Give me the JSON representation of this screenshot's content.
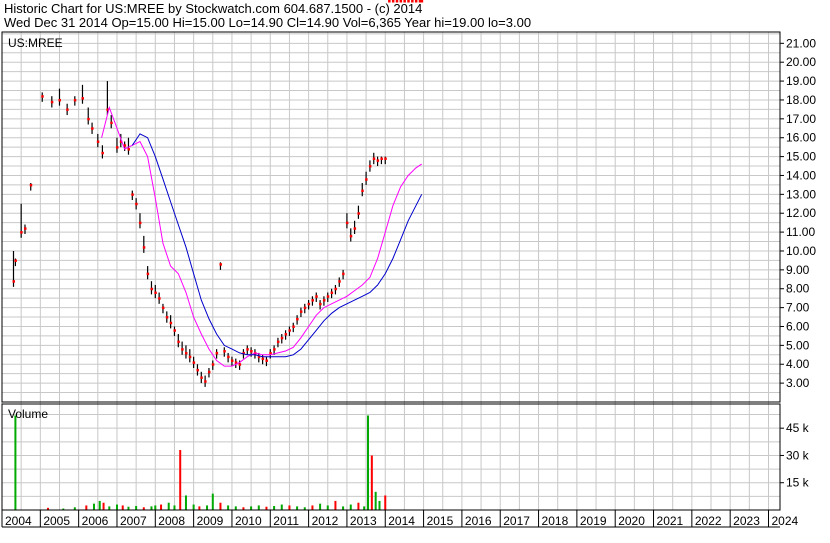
{
  "header": {
    "line1": "Historic Chart for US:MREE by Stockwatch.com 604.687.1500 - (c) 2014",
    "line2": "Wed Dec 31 2014   Op=15.00  Hi=15.00  Lo=14.90  Cl=14.90  Vol=6,365   Year hi=19.00  lo=3.00"
  },
  "colors": {
    "grid": "#c8c8c8",
    "price_bar": "#000000",
    "close_dot": "#ff0000",
    "ma_short": "#ff00ff",
    "ma_long": "#0000cc",
    "volume_up": "#00aa00",
    "volume_down": "#ff0000"
  },
  "chart_data": {
    "type": "line",
    "symbol_label": "US:MREE",
    "volume_label": "Volume",
    "x_ticks": [
      "2004",
      "2005",
      "2006",
      "2007",
      "2008",
      "2009",
      "2010",
      "2011",
      "2012",
      "2013",
      "2014",
      "2015",
      "2016",
      "2017",
      "2018",
      "2019",
      "2020",
      "2021",
      "2022",
      "2023",
      "2024"
    ],
    "y_ticks": [
      "3.00",
      "4.00",
      "5.00",
      "6.00",
      "7.00",
      "8.00",
      "9.00",
      "10.00",
      "11.00",
      "12.00",
      "13.00",
      "14.00",
      "15.00",
      "16.00",
      "17.00",
      "18.00",
      "19.00",
      "20.00",
      "21.00"
    ],
    "ylim": [
      2.0,
      21.6
    ],
    "volume_ticks": [
      "15 k",
      "30 k",
      "45 k"
    ],
    "volume_ylim": [
      0,
      55000
    ],
    "xlim": [
      2004.0,
      2024.3
    ],
    "series": [
      {
        "role": "price",
        "x": [
          2004.3,
          2004.35,
          2004.5,
          2004.6,
          2004.75,
          2005.05,
          2005.3,
          2005.5,
          2005.7,
          2005.9,
          2006.1,
          2006.25,
          2006.35,
          2006.5,
          2006.62,
          2006.75,
          2006.85,
          2007.0,
          2007.1,
          2007.2,
          2007.3,
          2007.4,
          2007.5,
          2007.6,
          2007.7,
          2007.8,
          2007.9,
          2008.0,
          2008.1,
          2008.2,
          2008.3,
          2008.4,
          2008.5,
          2008.6,
          2008.7,
          2008.8,
          2008.9,
          2009.0,
          2009.1,
          2009.2,
          2009.3,
          2009.4,
          2009.5,
          2009.6,
          2009.7,
          2009.8,
          2009.9,
          2010.0,
          2010.1,
          2010.2,
          2010.3,
          2010.4,
          2010.5,
          2010.6,
          2010.7,
          2010.8,
          2010.9,
          2011.0,
          2011.1,
          2011.2,
          2011.3,
          2011.4,
          2011.5,
          2011.6,
          2011.7,
          2011.8,
          2011.9,
          2012.0,
          2012.1,
          2012.2,
          2012.3,
          2012.4,
          2012.5,
          2012.6,
          2012.7,
          2012.8,
          2012.9,
          2013.0,
          2013.1,
          2013.2,
          2013.3,
          2013.4,
          2013.5,
          2013.6,
          2013.7,
          2013.8,
          2013.9,
          2014.0,
          2014.1,
          2014.2,
          2014.3,
          2014.4,
          2014.5,
          2014.6,
          2014.7,
          2014.8,
          2014.9,
          2014.95
        ],
        "high": [
          10.0,
          9.6,
          12.5,
          11.4,
          13.6,
          18.4,
          18.2,
          18.6,
          17.8,
          18.2,
          18.8,
          17.6,
          16.8,
          16.2,
          15.6,
          19.0,
          17.2,
          16.0,
          16.2,
          15.8,
          16.0,
          13.2,
          12.8,
          12.0,
          10.8,
          9.2,
          8.4,
          8.2,
          7.8,
          7.2,
          6.8,
          6.6,
          6.0,
          5.6,
          5.2,
          5.0,
          4.8,
          4.4,
          4.0,
          3.6,
          3.4,
          3.8,
          4.2,
          4.8,
          9.4,
          4.9,
          4.6,
          4.4,
          4.3,
          4.2,
          4.8,
          5.0,
          4.9,
          4.8,
          4.6,
          4.5,
          4.4,
          4.8,
          5.0,
          5.4,
          5.6,
          5.8,
          6.0,
          6.2,
          6.6,
          7.0,
          7.2,
          7.4,
          7.6,
          7.8,
          7.4,
          7.6,
          7.8,
          8.0,
          8.2,
          8.6,
          9.0,
          12.0,
          11.2,
          11.6,
          12.4,
          13.6,
          14.2,
          14.8,
          15.2,
          15.0,
          15.0,
          15.0
        ],
        "close": [
          8.4,
          9.5,
          11.0,
          11.2,
          13.5,
          18.2,
          17.9,
          18.0,
          17.5,
          18.0,
          18.1,
          17.0,
          16.5,
          15.8,
          15.2,
          17.5,
          16.8,
          15.5,
          15.8,
          15.6,
          15.4,
          13.0,
          12.5,
          11.5,
          10.2,
          8.8,
          8.0,
          7.8,
          7.5,
          7.0,
          6.5,
          6.2,
          5.8,
          5.2,
          4.8,
          4.6,
          4.4,
          4.1,
          3.7,
          3.3,
          3.1,
          3.6,
          4.0,
          4.6,
          9.3,
          4.7,
          4.4,
          4.2,
          4.1,
          4.0,
          4.6,
          4.8,
          4.7,
          4.6,
          4.4,
          4.3,
          4.2,
          4.6,
          4.8,
          5.2,
          5.4,
          5.6,
          5.8,
          6.0,
          6.4,
          6.8,
          7.0,
          7.2,
          7.4,
          7.6,
          7.2,
          7.4,
          7.6,
          7.8,
          8.0,
          8.4,
          8.8,
          11.5,
          10.8,
          11.2,
          12.0,
          13.2,
          13.8,
          14.5,
          14.9,
          14.8,
          14.9,
          14.9
        ]
      },
      {
        "role": "ma_short",
        "x": [
          2006.6,
          2006.8,
          2007.0,
          2007.2,
          2007.4,
          2007.6,
          2007.8,
          2008.0,
          2008.2,
          2008.4,
          2008.6,
          2008.8,
          2009.0,
          2009.2,
          2009.4,
          2009.6,
          2009.8,
          2010.0,
          2010.2,
          2010.4,
          2010.6,
          2010.8,
          2011.0,
          2011.2,
          2011.4,
          2011.6,
          2011.8,
          2012.0,
          2012.2,
          2012.4,
          2012.6,
          2012.8,
          2013.0,
          2013.2,
          2013.4,
          2013.6,
          2013.8,
          2014.0,
          2014.2,
          2014.4,
          2014.6,
          2014.8,
          2014.95
        ],
        "values": [
          16.0,
          17.6,
          16.5,
          15.4,
          15.6,
          15.8,
          15.0,
          12.8,
          10.4,
          9.2,
          8.8,
          7.8,
          6.5,
          5.6,
          4.8,
          4.2,
          3.9,
          3.9,
          4.1,
          4.4,
          4.6,
          4.5,
          4.5,
          4.6,
          4.7,
          4.9,
          5.4,
          6.0,
          6.6,
          7.0,
          7.2,
          7.4,
          7.6,
          7.9,
          8.2,
          8.6,
          9.6,
          11.0,
          12.4,
          13.4,
          14.0,
          14.4,
          14.6
        ]
      },
      {
        "role": "ma_long",
        "x": [
          2007.4,
          2007.6,
          2007.8,
          2008.0,
          2008.2,
          2008.4,
          2008.6,
          2008.8,
          2009.0,
          2009.2,
          2009.4,
          2009.6,
          2009.8,
          2010.0,
          2010.2,
          2010.4,
          2010.6,
          2010.8,
          2011.0,
          2011.2,
          2011.4,
          2011.6,
          2011.8,
          2012.0,
          2012.2,
          2012.4,
          2012.6,
          2012.8,
          2013.0,
          2013.2,
          2013.4,
          2013.6,
          2013.8,
          2014.0,
          2014.2,
          2014.4,
          2014.6,
          2014.8,
          2014.95
        ],
        "values": [
          15.6,
          16.2,
          16.0,
          15.0,
          13.8,
          12.6,
          11.4,
          10.2,
          8.8,
          7.4,
          6.4,
          5.6,
          5.0,
          4.8,
          4.6,
          4.5,
          4.5,
          4.4,
          4.4,
          4.4,
          4.4,
          4.5,
          4.8,
          5.3,
          5.8,
          6.3,
          6.7,
          7.0,
          7.2,
          7.4,
          7.6,
          7.8,
          8.2,
          8.8,
          9.6,
          10.6,
          11.6,
          12.4,
          13.0
        ]
      },
      {
        "role": "volume",
        "x": [
          2004.35,
          2005.2,
          2005.6,
          2005.9,
          2006.2,
          2006.4,
          2006.55,
          2006.65,
          2006.8,
          2007.0,
          2007.15,
          2007.3,
          2007.5,
          2007.7,
          2007.9,
          2008.0,
          2008.15,
          2008.35,
          2008.5,
          2008.65,
          2008.8,
          2009.0,
          2009.15,
          2009.35,
          2009.5,
          2009.7,
          2009.9,
          2010.1,
          2010.3,
          2010.5,
          2010.7,
          2010.9,
          2011.1,
          2011.3,
          2011.5,
          2011.7,
          2011.9,
          2012.1,
          2012.3,
          2012.5,
          2012.7,
          2012.9,
          2013.1,
          2013.3,
          2013.45,
          2013.55,
          2013.65,
          2013.75,
          2013.85,
          2014.0
        ],
        "values": [
          52000,
          1200,
          800,
          1500,
          2500,
          3500,
          5000,
          4000,
          2000,
          3000,
          2500,
          1800,
          2200,
          1500,
          2000,
          2500,
          3000,
          4000,
          2500,
          33000,
          8000,
          3000,
          2000,
          2500,
          9000,
          4000,
          2500,
          2000,
          1500,
          2000,
          2500,
          1800,
          2200,
          3000,
          2500,
          2000,
          1500,
          2500,
          3500,
          2500,
          5000,
          2000,
          3000,
          4000,
          2000,
          52000,
          30000,
          10000,
          5000,
          8000
        ]
      }
    ]
  }
}
